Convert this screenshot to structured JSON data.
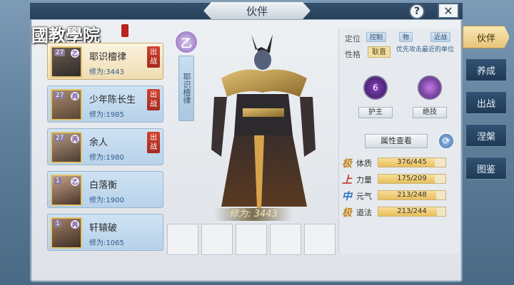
{
  "window": {
    "title": "伙伴",
    "help": "?",
    "close": "✕"
  },
  "logo": {
    "text": "國教學院"
  },
  "companions": [
    {
      "level": "27",
      "rank": "乙",
      "name": "耶识檀律",
      "power": "修为:3443",
      "deployed": "出战",
      "selected": true
    },
    {
      "level": "27",
      "rank": "丙",
      "name": "少年陈长生",
      "power": "修为:1985",
      "deployed": "出战",
      "selected": false
    },
    {
      "level": "27",
      "rank": "丙",
      "name": "余人",
      "power": "修为:1980",
      "deployed": "出战",
      "selected": false
    },
    {
      "level": "1",
      "rank": "乙",
      "name": "白落衡",
      "power": "修为:1900",
      "deployed": "",
      "selected": false
    },
    {
      "level": "1",
      "rank": "丙",
      "name": "轩辕破",
      "power": "修为:1065",
      "deployed": "",
      "selected": false
    }
  ],
  "hero": {
    "element_badge": "乙",
    "vertical_name": "耶识檀律",
    "power_text": "修为: 3443"
  },
  "info": {
    "position_label": "定位",
    "positions": [
      "控制",
      "物",
      "近战"
    ],
    "personality_label": "性格",
    "personality": "耿直",
    "personality_desc": "优先攻击最近的单位",
    "skill1_label": "护主",
    "skill1_level": "6",
    "skill2_label": "绝技",
    "view_attrs": "属性查看",
    "attributes": [
      {
        "grade": "极",
        "grade_color": "#c2851f",
        "name": "体质",
        "value": "376/445",
        "fill": 0.845
      },
      {
        "grade": "上",
        "grade_color": "#c0392b",
        "name": "力量",
        "value": "175/209",
        "fill": 0.837
      },
      {
        "grade": "中",
        "grade_color": "#2a6fc4",
        "name": "元气",
        "value": "213/248",
        "fill": 0.859
      },
      {
        "grade": "极",
        "grade_color": "#c2851f",
        "name": "道法",
        "value": "213/244",
        "fill": 0.873
      }
    ]
  },
  "tabs": [
    "伙伴",
    "养成",
    "出战",
    "涅槃",
    "图鉴"
  ]
}
